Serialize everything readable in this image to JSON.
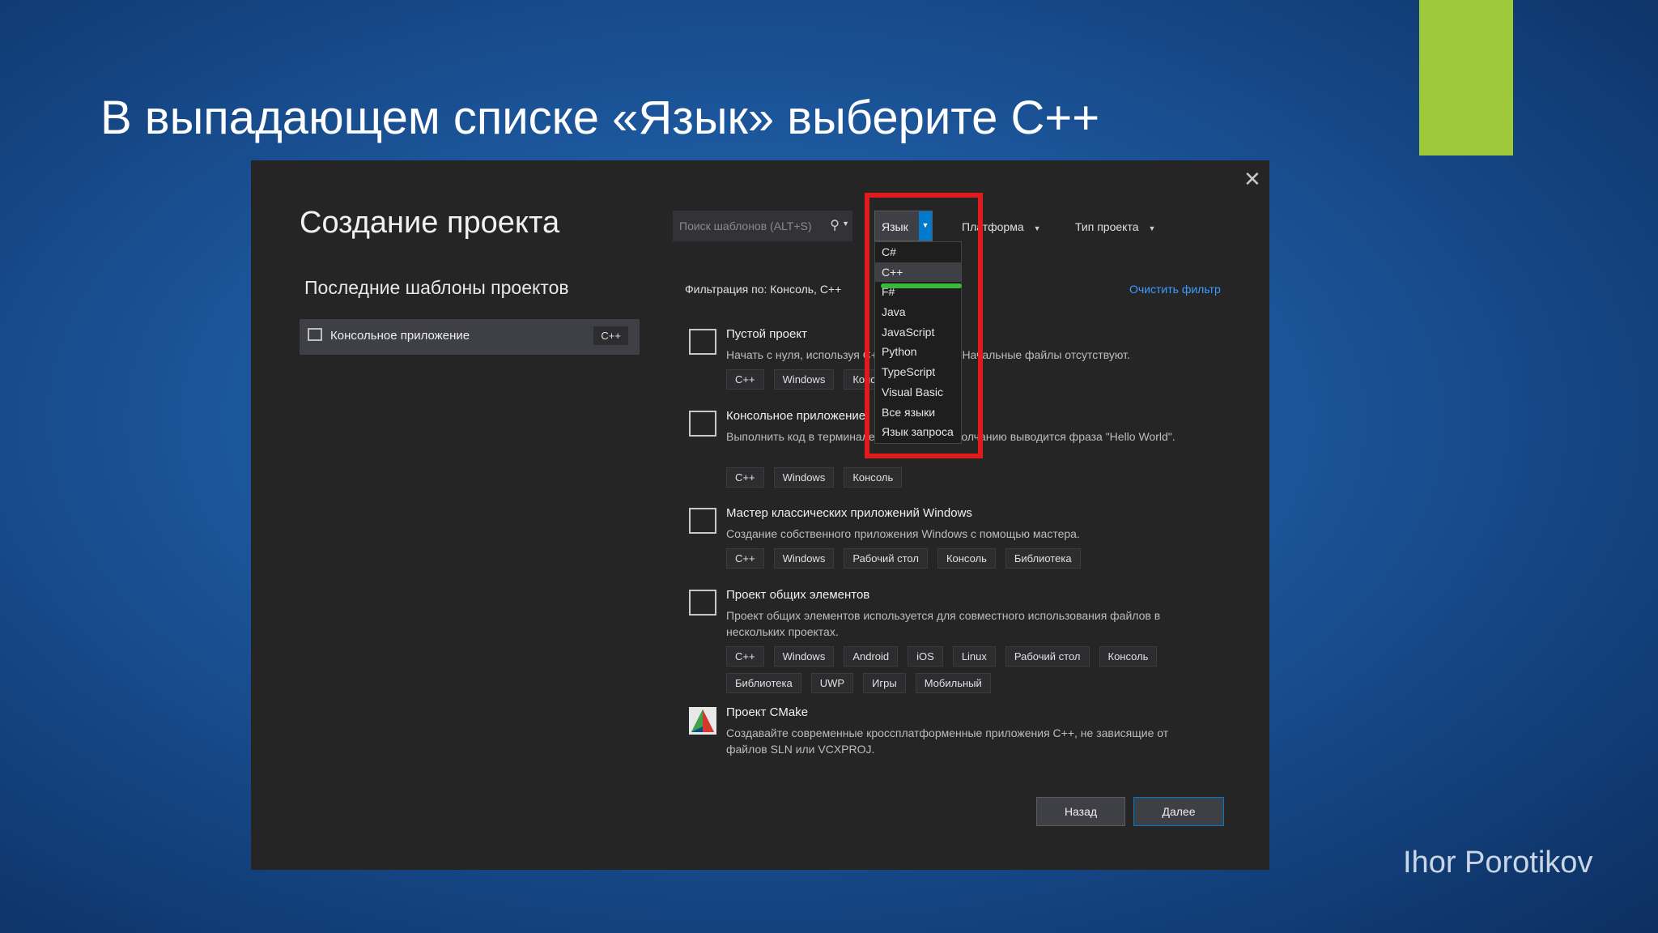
{
  "slide": {
    "title": "В выпадающем списке «Язык» выберите С++",
    "author": "Ihor Porotikov",
    "accent_color": "#9dc93a"
  },
  "dialog": {
    "title": "Создание проекта",
    "close_icon": "close-icon",
    "recent": {
      "heading": "Последние шаблоны проектов",
      "items": [
        {
          "label": "Консольное приложение",
          "tag": "C++"
        }
      ]
    },
    "search": {
      "placeholder": "Поиск шаблонов (ALT+S)"
    },
    "filters": {
      "language": "Язык",
      "platform": "Платформа",
      "project_type": "Тип проекта"
    },
    "filter_label": "Фильтрация по: Консоль, C++",
    "clear_filter": "Очистить фильтр",
    "language_menu": {
      "items": [
        "C#",
        "C++",
        "F#",
        "Java",
        "JavaScript",
        "Python",
        "TypeScript",
        "Visual Basic",
        "Все языки",
        "Язык запроса"
      ],
      "selected": "C++"
    },
    "templates": [
      {
        "name": "Пустой проект",
        "desc": "Начать с нуля, используя C++ для Windows. Начальные файлы отсутствуют.",
        "tags": [
          "C++",
          "Windows",
          "Консоль"
        ]
      },
      {
        "name": "Консольное приложение",
        "desc": "Выполнить код в терминале Windows. По умолчанию выводится фраза \"Hello World\".",
        "tags": [
          "C++",
          "Windows",
          "Консоль"
        ]
      },
      {
        "name": "Мастер классических приложений Windows",
        "desc": "Создание собственного приложения Windows с помощью мастера.",
        "tags": [
          "C++",
          "Windows",
          "Рабочий стол",
          "Консоль",
          "Библиотека"
        ]
      },
      {
        "name": "Проект общих элементов",
        "desc": "Проект общих элементов используется для совместного использования файлов в нескольких проектах.",
        "tags": [
          "C++",
          "Windows",
          "Android",
          "iOS",
          "Linux",
          "Рабочий стол",
          "Консоль",
          "Библиотека",
          "UWP",
          "Игры",
          "Мобильный"
        ]
      },
      {
        "name": "Проект CMake",
        "desc": "Создавайте современные кроссплатформенные приложения C++, не зависящие от файлов SLN или VCXPROJ.",
        "tags": []
      }
    ],
    "buttons": {
      "back": "Назад",
      "next": "Далее"
    },
    "highlight_color": "#e01b1b"
  }
}
